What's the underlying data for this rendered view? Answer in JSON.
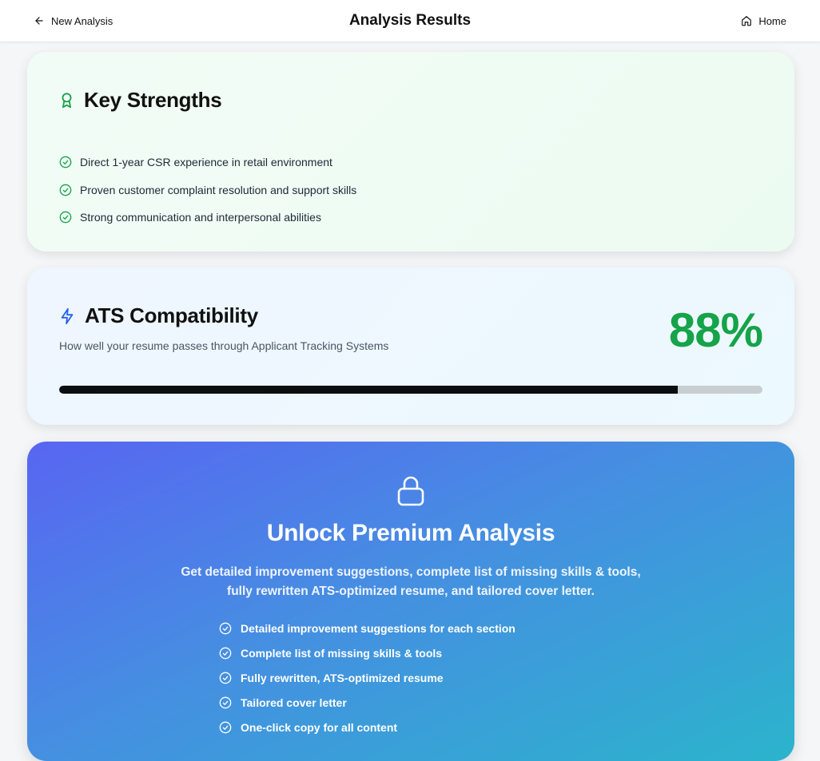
{
  "header": {
    "back_label": "New Analysis",
    "title": "Analysis Results",
    "home_label": "Home"
  },
  "strengths": {
    "title": "Key Strengths",
    "icon": "award-icon",
    "items": [
      "Direct 1-year CSR experience in retail environment",
      "Proven customer complaint resolution and support skills",
      "Strong communication and interpersonal abilities"
    ]
  },
  "ats": {
    "title": "ATS Compatibility",
    "icon": "lightning-icon",
    "subtitle": "How well your resume passes through Applicant Tracking Systems",
    "score_label": "88%",
    "progress_percent": 88
  },
  "premium": {
    "icon": "lock-icon",
    "title": "Unlock Premium Analysis",
    "description": "Get detailed improvement suggestions, complete list of missing skills & tools, fully rewritten ATS-optimized resume, and tailored cover letter.",
    "features": [
      "Detailed improvement suggestions for each section",
      "Complete list of missing skills & tools",
      "Fully rewritten, ATS-optimized resume",
      "Tailored cover letter",
      "One-click copy for all content"
    ]
  },
  "colors": {
    "success": "#16a34a",
    "accent_blue": "#2563eb",
    "premium_gradient_start": "#5865f2",
    "premium_gradient_end": "#2bb4cc"
  }
}
